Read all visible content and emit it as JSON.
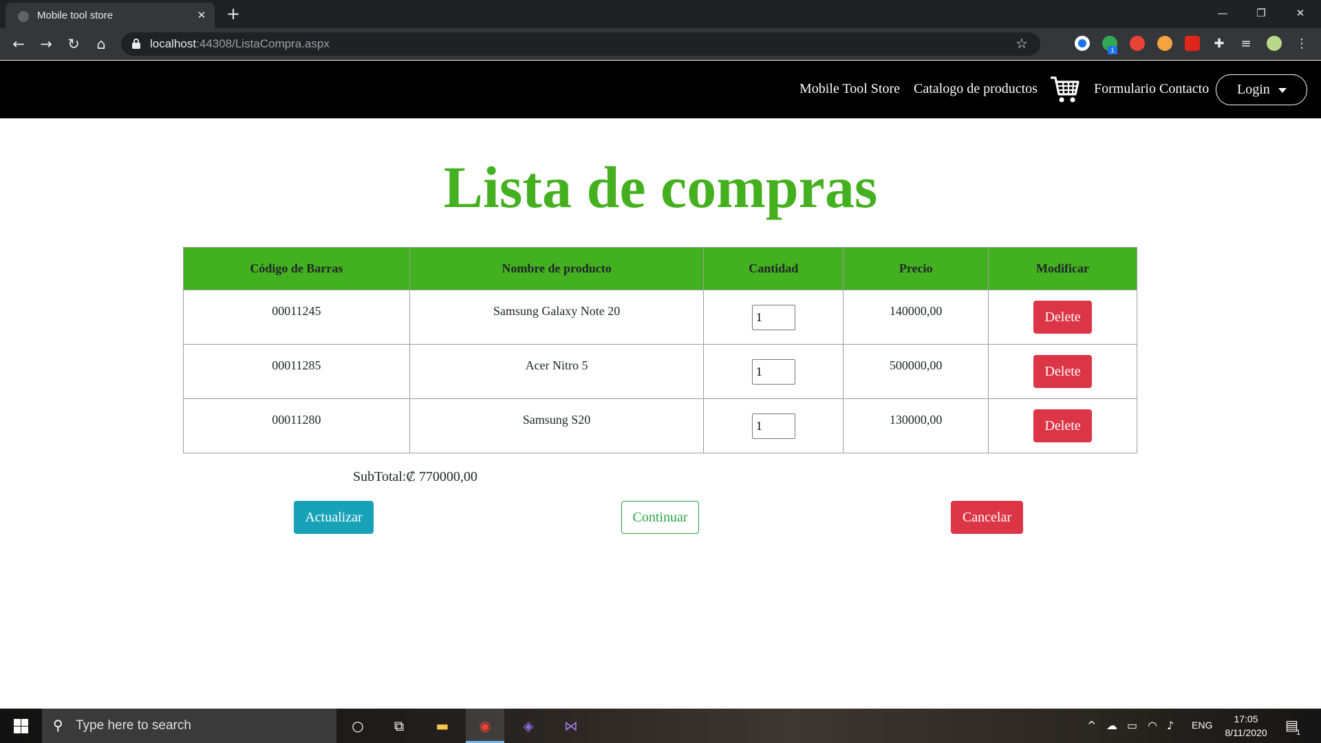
{
  "browser": {
    "tab_title": "Mobile tool store",
    "url_host": "localhost",
    "url_rest": ":44308/ListaCompra.aspx",
    "new_tab_symbol": "+",
    "close_symbol": "✕"
  },
  "navbar": {
    "brand": "Mobile Tool Store",
    "catalog": "Catalogo de productos",
    "cart_icon": "shopping-cart-icon",
    "contact": "Formulario Contacto",
    "login": "Login"
  },
  "page": {
    "title": "Lista de compras"
  },
  "table": {
    "headers": [
      "Código de Barras",
      "Nombre de producto",
      "Cantidad",
      "Precio",
      "Modificar"
    ],
    "rows": [
      {
        "code": "00011245",
        "name": "Samsung Galaxy Note 20",
        "qty": "1",
        "price": "140000,00",
        "action": "Delete"
      },
      {
        "code": "00011285",
        "name": "Acer Nitro 5",
        "qty": "1",
        "price": "500000,00",
        "action": "Delete"
      },
      {
        "code": "00011280",
        "name": "Samsung S20",
        "qty": "1",
        "price": "130000,00",
        "action": "Delete"
      }
    ]
  },
  "summary": {
    "subtotal": "SubTotal:₡ 770000,00"
  },
  "actions": {
    "update": "Actualizar",
    "continue": "Continuar",
    "cancel": "Cancelar"
  },
  "taskbar": {
    "search_placeholder": "Type here to search",
    "language": "ENG",
    "time": "17:05",
    "date": "8/11/2020",
    "notification_count": "1"
  },
  "colors": {
    "accent_green": "#45b01f",
    "header_green": "#43b020",
    "danger": "#dc3545",
    "info": "#17a2b8",
    "success": "#28a745"
  }
}
